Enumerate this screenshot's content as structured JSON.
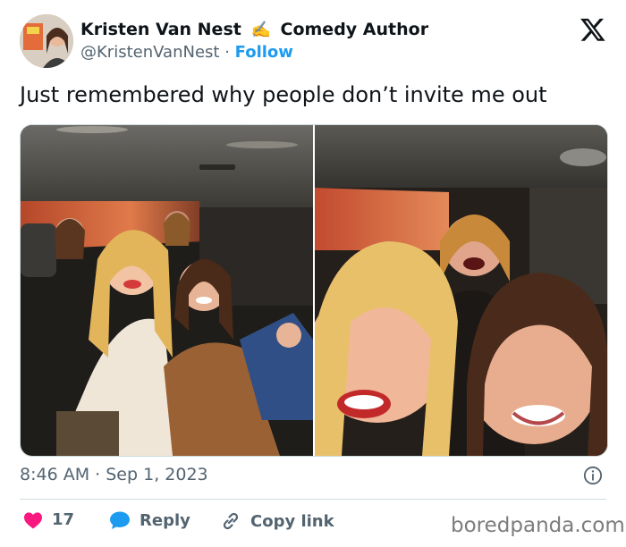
{
  "author": {
    "display_name_part1": "Kristen Van Nest",
    "display_name_emoji": "✍️",
    "display_name_part2": "Comedy Author",
    "handle": "@KristenVanNest",
    "separator": "·",
    "follow_label": "Follow",
    "avatar_icon": "profile-photo-avatar"
  },
  "platform_logo": "x-logo-icon",
  "tweet": {
    "text": "Just remembered why people don’t invite me out"
  },
  "media": {
    "photos": [
      "group-selfie-in-car-photo",
      "close-up-selfie-in-car-photo"
    ]
  },
  "meta": {
    "time": "8:46 AM",
    "separator": "·",
    "date": "Sep 1, 2023",
    "info_icon": "info-icon"
  },
  "actions": {
    "like_count": "17",
    "reply_label": "Reply",
    "copy_link_label": "Copy link",
    "like_color": "#f91880",
    "reply_color": "#1d9bf0"
  },
  "watermark": "boredpanda.com"
}
